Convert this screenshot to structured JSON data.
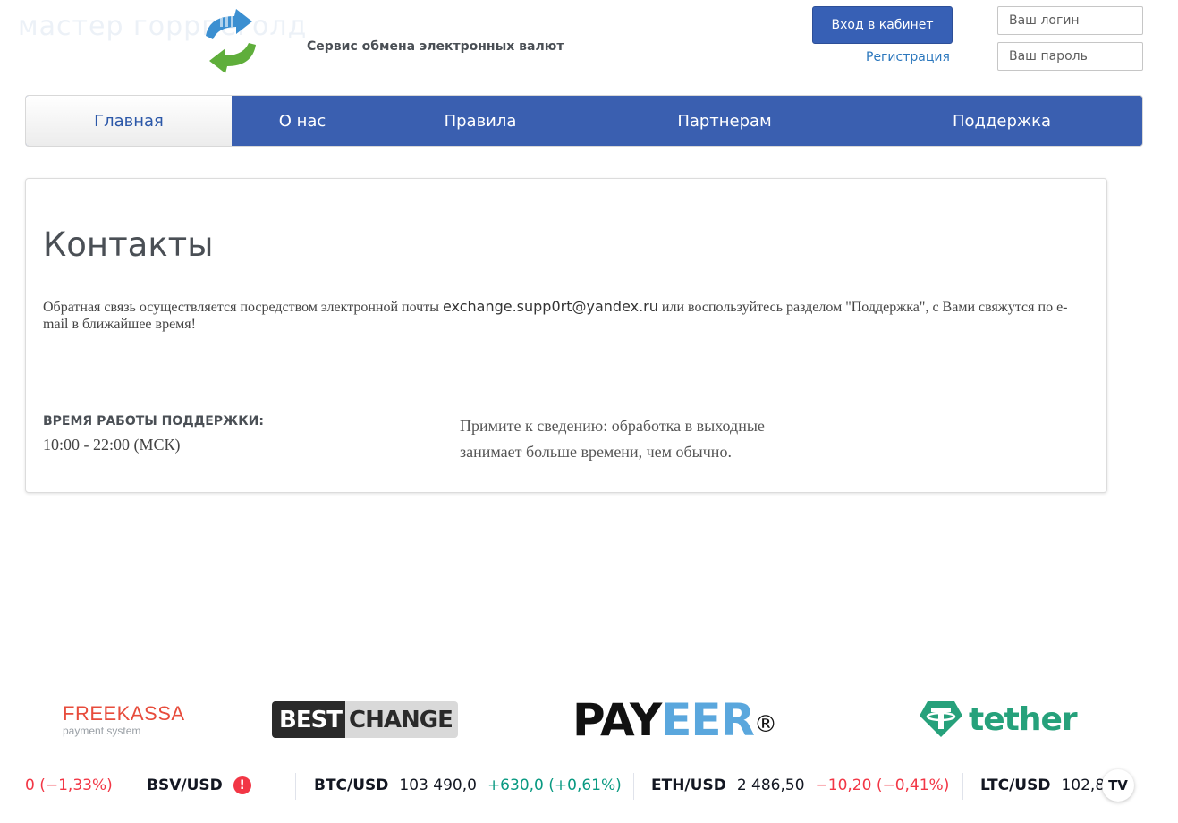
{
  "header": {
    "watermark": "мастер горрпеголд",
    "tagline": "Сервис обмена электронных валют",
    "login_button": "Вход в кабинет",
    "register_link": "Регистрация",
    "login_placeholder": "Ваш логин",
    "password_placeholder": "Ваш пароль"
  },
  "nav": {
    "items": [
      {
        "label": "Главная"
      },
      {
        "label": "О нас"
      },
      {
        "label": "Правила"
      },
      {
        "label": "Партнерам"
      },
      {
        "label": "Поддержка"
      }
    ]
  },
  "content": {
    "title": "Контакты",
    "feedback_before": "Обратная связь осуществляется посредством электронной почты ",
    "email": "exchange.supp0rt@yandex.ru",
    "feedback_after": "  или воспользуйтесь разделом \"Поддержка\", с Вами свяжутся по e-mail в ближайшее время!",
    "hours_label": "ВРЕМЯ РАБОТЫ ПОДДЕРЖКИ:",
    "hours_value": "10:00 - 22:00 (МСК)",
    "notice": "Примите к сведению: обработка в выходные занимает больше времени, чем обычно."
  },
  "partners": {
    "freekassa_name": "FREEKASSA",
    "freekassa_sub": "payment system",
    "bestchange_left": "BEST",
    "bestchange_right": "CHANGE",
    "payeer_part1": "PAY",
    "payeer_part2": "EER",
    "payeer_reg": "®",
    "tether": "tether"
  },
  "ticker": {
    "first_change": "0 (−1,33%)",
    "items": [
      {
        "symbol": "BSV/USD"
      },
      {
        "symbol": "BTC/USD",
        "price": "103 490,0",
        "change": "+630,0 (+0,61%)"
      },
      {
        "symbol": "ETH/USD",
        "price": "2 486,50",
        "change": "−10,20 (−0,41%)"
      },
      {
        "symbol": "LTC/USD",
        "price": "102,8"
      }
    ],
    "badge": "TV"
  },
  "colors": {
    "brand_blue": "#3a5fb0",
    "link_blue": "#2b77bd",
    "up_green": "#089981",
    "down_red": "#f23645",
    "tether_green": "#26a17b"
  }
}
